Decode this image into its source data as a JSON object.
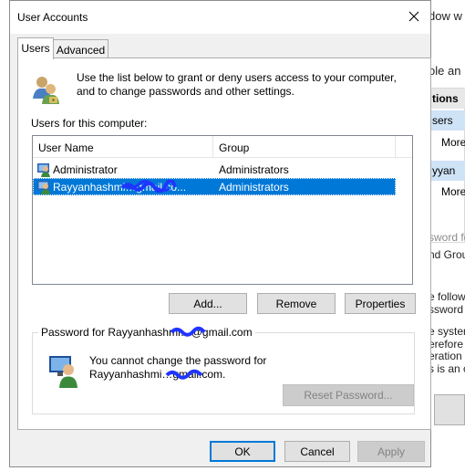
{
  "dialog": {
    "title": "User Accounts",
    "tabs": [
      {
        "label": "Users",
        "active": true
      },
      {
        "label": "Advanced",
        "active": false
      }
    ],
    "intro_text_line1": "Use the list below to grant or deny users access to your computer,",
    "intro_text_line2": "and to change passwords and other settings.",
    "users_label": "Users for this computer:",
    "list": {
      "columns": [
        "User Name",
        "Group"
      ],
      "rows": [
        {
          "name": "Administrator",
          "group": "Administrators",
          "selected": false
        },
        {
          "name": "Rayyanhashmi…gmail.co...",
          "group": "Administrators",
          "selected": true
        }
      ]
    },
    "buttons": {
      "add": "Add...",
      "remove": "Remove",
      "properties": "Properties",
      "reset_password": "Reset Password...",
      "ok": "OK",
      "cancel": "Cancel",
      "apply": "Apply"
    },
    "password_group": {
      "legend": "Password for Rayyanhashmi…@gmail.com",
      "line1": "You cannot change the password for",
      "line2": "Rayyanhashmi…gmail.com."
    },
    "colors": {
      "selection": "#0078d7",
      "dialog_bg": "#f0f0f0",
      "redaction": "#1f35ff"
    },
    "icons": [
      "users-icon",
      "user-icon",
      "close-icon"
    ]
  },
  "background_window": {
    "title_fragment": "dow w",
    "subtitle_fragment": "ole an",
    "column_fragment": "tions",
    "row1": "sers",
    "row1_more": "More",
    "row2": "yyan",
    "row2_more": "More",
    "text_lines": [
      {
        "text": "sword fo",
        "gray": true
      },
      {
        "text": "nd Grou",
        "gray": false
      },
      {
        "text": "e follow",
        "gray": false
      },
      {
        "text": "ssword f",
        "gray": false
      },
      {
        "text": "e system",
        "gray": false
      },
      {
        "text": "erefore c",
        "gray": false
      },
      {
        "text": "eration",
        "gray": false
      },
      {
        "text": "s is an c",
        "gray": false
      }
    ]
  }
}
